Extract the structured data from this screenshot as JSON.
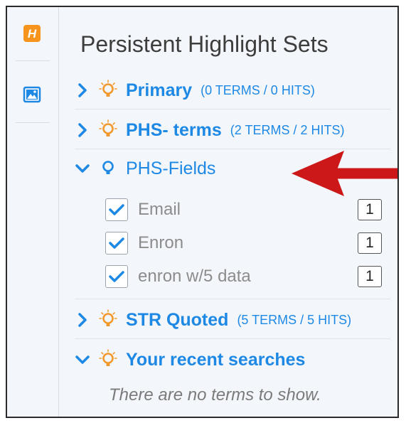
{
  "app": {
    "logo_letter": "H"
  },
  "panel": {
    "title": "Persistent Highlight Sets"
  },
  "sets": [
    {
      "name": "Primary",
      "meta": "(0 TERMS / 0 HITS)",
      "expanded": false
    },
    {
      "name": "PHS- terms",
      "meta": "(2 TERMS / 2 HITS)",
      "expanded": false
    },
    {
      "name": "PHS-Fields",
      "meta": "",
      "expanded": true,
      "terms": [
        {
          "label": "Email",
          "count": "1",
          "checked": true
        },
        {
          "label": "Enron",
          "count": "1",
          "checked": true
        },
        {
          "label": "enron w/5 data",
          "count": "1",
          "checked": true
        }
      ]
    },
    {
      "name": "STR Quoted",
      "meta": "(5 TERMS / 5 HITS)",
      "expanded": false
    },
    {
      "name": "Your recent searches",
      "meta": "",
      "expanded": true
    }
  ],
  "recent": {
    "empty_message": "There are no terms to show."
  },
  "colors": {
    "accent": "#1e88e5",
    "bulb_orange": "#f39a2e",
    "arrow_red": "#cc1818",
    "logo_orange": "#f7941d"
  }
}
